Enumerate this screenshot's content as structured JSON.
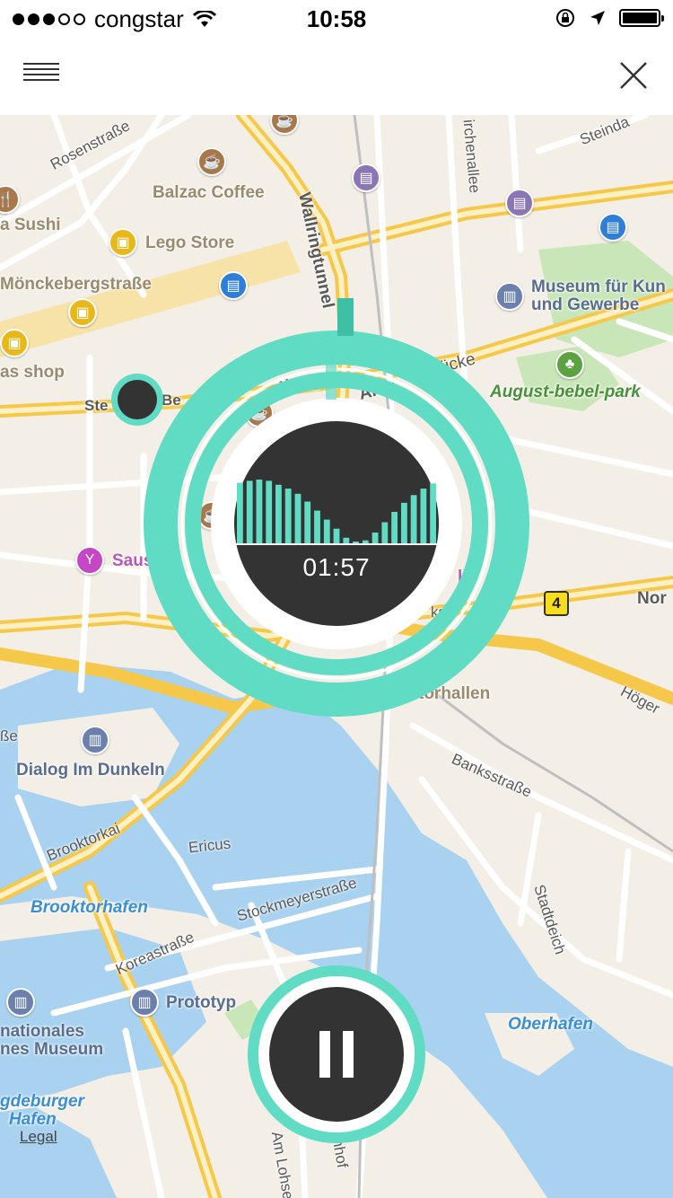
{
  "status_bar": {
    "carrier": "congstar",
    "time": "10:58",
    "signal_full": 3,
    "signal_total": 5,
    "icons": [
      "wifi-icon",
      "rotation-lock-icon",
      "location-arrow-icon",
      "battery-icon"
    ]
  },
  "nav": {
    "menu_icon": "hamburger-menu-icon",
    "close_icon": "close-icon"
  },
  "map": {
    "labels": {
      "rosenstrasse": "Rosenstraße",
      "balzac": "Balzac Coffee",
      "sushi": "a Sushi",
      "lego": "Lego Store",
      "moenckeberg": "Mönckebergstraße",
      "shop": "as shop",
      "wallring": "Wallringtunnel",
      "kirchenallee": "irchenallee",
      "steinda": "Steinda",
      "museum1": "Museum für Kun",
      "museum2": "und Gewerbe",
      "bruecke": "ücke",
      "altm": "Altm",
      "augustpark": "August-bebel-park",
      "suite": "Suite",
      "ste": "Ste",
      "be": "Be",
      "saus": "Saus",
      "ibi": "lbi",
      "kstr": "kstr",
      "nor": "Nor",
      "hoeger": "Höger",
      "torhallen": "torhallen",
      "sse": "ße",
      "dialog": "Dialog Im Dunkeln",
      "banks": "Banksstraße",
      "brooktorkai": "Brooktorkai",
      "ericus": "Ericus",
      "brooktorhafen": "Brooktorhafen",
      "stockmeyer": "Stockmeyerstraße",
      "stadtdeich": "Stadtdeich",
      "korea": "Koreastraße",
      "prototyp": "Prototyp",
      "nationales": "nationales",
      "museum3": "nes Museum",
      "oberhafen": "Oberhafen",
      "magdeburger": "gdeburger",
      "hafen": "Hafen",
      "amlohse": "Am Lohse",
      "hof": "nhof",
      "road_number": "4"
    },
    "legal": "Legal"
  },
  "player": {
    "elapsed": "01:57",
    "waveform": [
      0.95,
      0.98,
      1.0,
      0.98,
      0.92,
      0.86,
      0.78,
      0.66,
      0.52,
      0.38,
      0.24,
      0.1,
      0.04,
      0.06,
      0.18,
      0.34,
      0.5,
      0.64,
      0.76,
      0.86,
      0.94
    ],
    "accent_color": "#5fdcc3",
    "dark_color": "#333333",
    "progress": 0.02
  },
  "controls": {
    "state": "playing",
    "pause_icon": "pause-icon"
  }
}
